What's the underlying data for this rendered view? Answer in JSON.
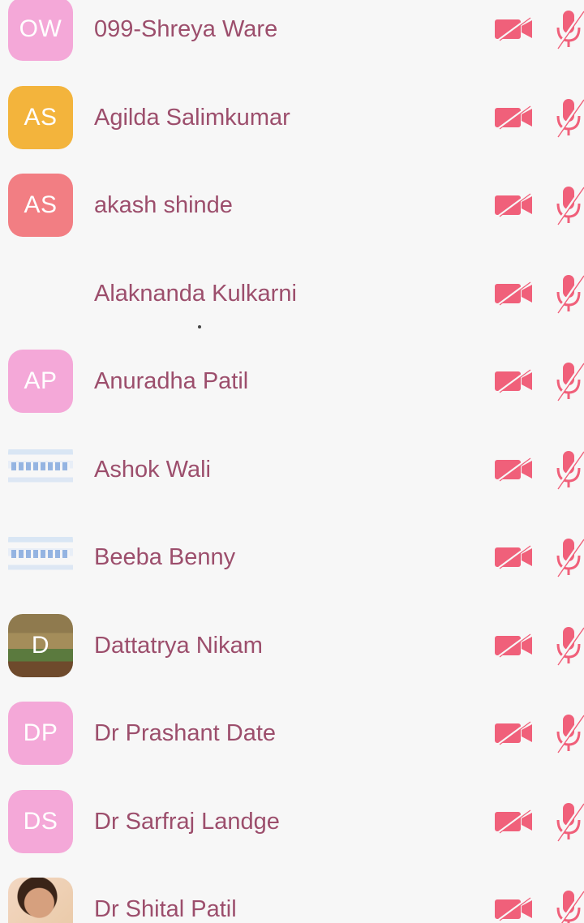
{
  "accent_color": "#f0607a",
  "participants": [
    {
      "initials": "OW",
      "name": "099-Shreya Ware",
      "avatar_style": "pink",
      "camera_icon": "camera-off-icon",
      "mic_icon": "mic-off-icon"
    },
    {
      "initials": "AS",
      "name": "Agilda Salimkumar",
      "avatar_style": "orange",
      "camera_icon": "camera-off-icon",
      "mic_icon": "mic-off-icon"
    },
    {
      "initials": "AS",
      "name": "akash shinde",
      "avatar_style": "salmon",
      "camera_icon": "camera-off-icon",
      "mic_icon": "mic-off-icon"
    },
    {
      "initials": "",
      "name": "Alaknanda Kulkarni",
      "avatar_style": "none",
      "camera_icon": "camera-off-icon",
      "mic_icon": "mic-off-icon"
    },
    {
      "initials": "AP",
      "name": "Anuradha Patil",
      "avatar_style": "pink",
      "camera_icon": "camera-off-icon",
      "mic_icon": "mic-off-icon"
    },
    {
      "initials": "",
      "name": "Ashok Wali",
      "avatar_style": "striped",
      "camera_icon": "camera-off-icon",
      "mic_icon": "mic-off-icon"
    },
    {
      "initials": "",
      "name": "Beeba Benny",
      "avatar_style": "striped",
      "camera_icon": "camera-off-icon",
      "mic_icon": "mic-off-icon"
    },
    {
      "initials": "D",
      "name": "Dattatrya Nikam",
      "avatar_style": "field",
      "camera_icon": "camera-off-icon",
      "mic_icon": "mic-off-icon"
    },
    {
      "initials": "DP",
      "name": "Dr Prashant Date",
      "avatar_style": "pink",
      "camera_icon": "camera-off-icon",
      "mic_icon": "mic-off-icon"
    },
    {
      "initials": "DS",
      "name": "Dr Sarfraj Landge",
      "avatar_style": "pink",
      "camera_icon": "camera-off-icon",
      "mic_icon": "mic-off-icon"
    },
    {
      "initials": "",
      "name": "Dr Shital Patil",
      "avatar_style": "photo",
      "camera_icon": "camera-off-icon",
      "mic_icon": "mic-off-icon"
    }
  ]
}
